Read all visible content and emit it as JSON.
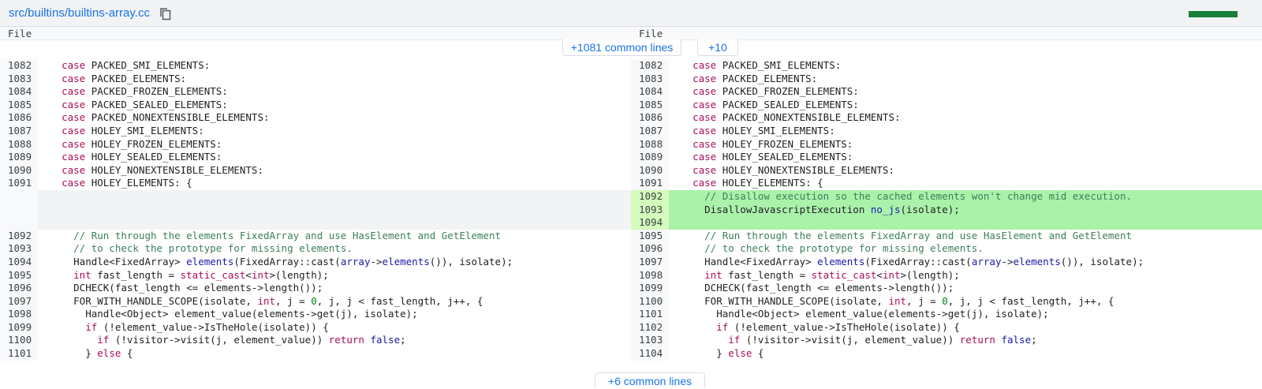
{
  "header": {
    "file_path": "src/builtins/builtins-array.cc",
    "copy_icon": "copy-icon",
    "progress_color": "#188038"
  },
  "columns": {
    "left": "File",
    "right": "File"
  },
  "expand": {
    "common_top": "+1081 common lines",
    "more_top": "+10",
    "common_bottom": "+6 common lines"
  },
  "colors": {
    "added_background": "#aaf2aa",
    "keyword": "#aa0d5b",
    "function": "#1a1aa6",
    "link": "#1a73e8"
  },
  "rows": [
    {
      "l": "1082",
      "r": "1082",
      "code": "    case PACKED_SMI_ELEMENTS:"
    },
    {
      "l": "1083",
      "r": "1083",
      "code": "    case PACKED_ELEMENTS:"
    },
    {
      "l": "1084",
      "r": "1084",
      "code": "    case PACKED_FROZEN_ELEMENTS:"
    },
    {
      "l": "1085",
      "r": "1085",
      "code": "    case PACKED_SEALED_ELEMENTS:"
    },
    {
      "l": "1086",
      "r": "1086",
      "code": "    case PACKED_NONEXTENSIBLE_ELEMENTS:"
    },
    {
      "l": "1087",
      "r": "1087",
      "code": "    case HOLEY_SMI_ELEMENTS:"
    },
    {
      "l": "1088",
      "r": "1088",
      "code": "    case HOLEY_FROZEN_ELEMENTS:"
    },
    {
      "l": "1089",
      "r": "1089",
      "code": "    case HOLEY_SEALED_ELEMENTS:"
    },
    {
      "l": "1090",
      "r": "1090",
      "code": "    case HOLEY_NONEXTENSIBLE_ELEMENTS:"
    },
    {
      "l": "1091",
      "r": "1091",
      "code": "    case HOLEY_ELEMENTS: {"
    },
    {
      "l": "",
      "r": "1092",
      "added": true,
      "code": "      // Disallow execution so the cached elements won't change mid execution."
    },
    {
      "l": "",
      "r": "1093",
      "added": true,
      "code": "      DisallowJavascriptExecution no_js(isolate);"
    },
    {
      "l": "",
      "r": "1094",
      "added": true,
      "code": ""
    },
    {
      "l": "1092",
      "r": "1095",
      "code": "      // Run through the elements FixedArray and use HasElement and GetElement"
    },
    {
      "l": "1093",
      "r": "1096",
      "code": "      // to check the prototype for missing elements."
    },
    {
      "l": "1094",
      "r": "1097",
      "code": "      Handle<FixedArray> elements(FixedArray::cast(array->elements()), isolate);"
    },
    {
      "l": "1095",
      "r": "1098",
      "code": "      int fast_length = static_cast<int>(length);"
    },
    {
      "l": "1096",
      "r": "1099",
      "code": "      DCHECK(fast_length <= elements->length());"
    },
    {
      "l": "1097",
      "r": "1100",
      "code": "      FOR_WITH_HANDLE_SCOPE(isolate, int, j = 0, j, j < fast_length, j++, {"
    },
    {
      "l": "1098",
      "r": "1101",
      "code": "        Handle<Object> element_value(elements->get(j), isolate);"
    },
    {
      "l": "1099",
      "r": "1102",
      "code": "        if (!element_value->IsTheHole(isolate)) {"
    },
    {
      "l": "1100",
      "r": "1103",
      "code": "          if (!visitor->visit(j, element_value)) return false;"
    },
    {
      "l": "1101",
      "r": "1104",
      "code": "        } else {"
    }
  ]
}
